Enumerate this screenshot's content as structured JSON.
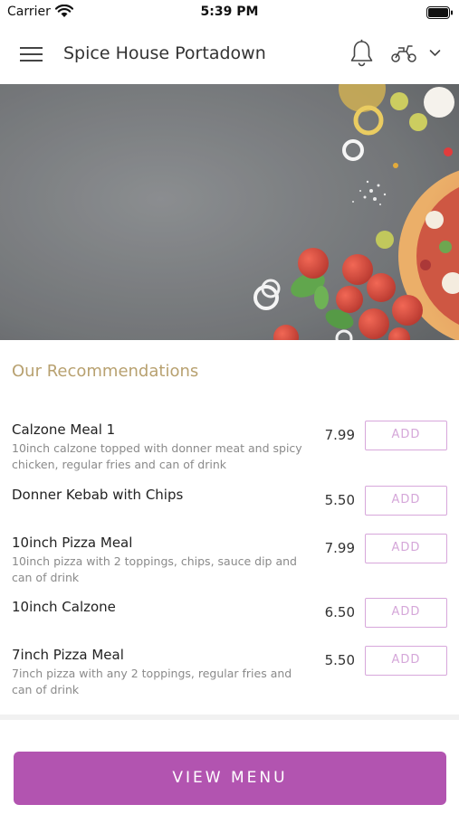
{
  "status_bar": {
    "carrier": "Carrier",
    "time": "5:39 PM"
  },
  "header": {
    "title": "Spice House Portadown",
    "icons": [
      "hamburger-menu-icon",
      "bell-icon",
      "scooter-icon",
      "chevron-down-icon"
    ]
  },
  "hero": {
    "image": "food-ingredients-photo"
  },
  "recommendations": {
    "title": "Our Recommendations",
    "items": [
      {
        "name": "Calzone Meal 1",
        "description": "10inch calzone topped with donner meat and spicy chicken, regular fries and can of drink",
        "price": "7.99",
        "add_label": "ADD"
      },
      {
        "name": "Donner Kebab with Chips",
        "description": "",
        "price": "5.50",
        "add_label": "ADD"
      },
      {
        "name": "10inch Pizza Meal",
        "description": "10inch pizza with 2 toppings, chips, sauce dip and can of drink",
        "price": "7.99",
        "add_label": "ADD"
      },
      {
        "name": "10inch Calzone",
        "description": "",
        "price": "6.50",
        "add_label": "ADD"
      },
      {
        "name": "7inch Pizza Meal",
        "description": "7inch pizza with any 2 toppings, regular fries and can of drink",
        "price": "5.50",
        "add_label": "ADD"
      }
    ]
  },
  "view_menu_label": "VIEW MENU",
  "colors": {
    "accent": "#b254b0",
    "section_title": "#b8a170",
    "add_border": "#d7a7db"
  }
}
